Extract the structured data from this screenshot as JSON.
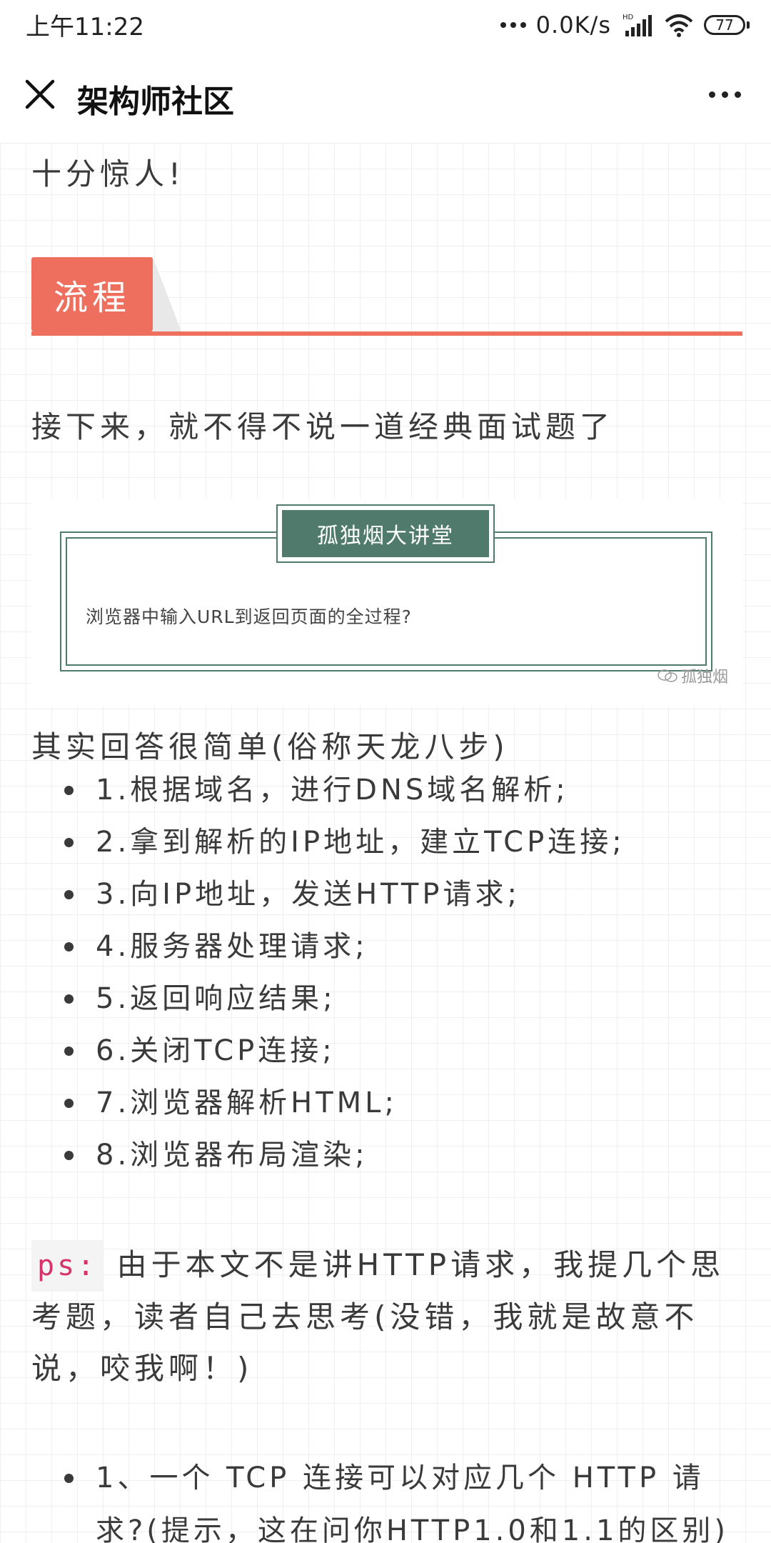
{
  "status_bar": {
    "time": "上午11:22",
    "speed": "0.0K/s",
    "network_badge": "HD",
    "battery": "77"
  },
  "nav": {
    "title": "架构师社区"
  },
  "article": {
    "intro_text": "十分惊人!",
    "section_title": "流程",
    "lead_text": "接下来，就不得不说一道经典面试题了",
    "card": {
      "title": "孤独烟大讲堂",
      "question": "浏览器中输入URL到返回页面的全过程?",
      "watermark": "孤独烟"
    },
    "answer_intro": "其实回答很简单(俗称天龙八步)",
    "steps": [
      "1.根据域名，进行DNS域名解析;",
      "2.拿到解析的IP地址，建立TCP连接;",
      "3.向IP地址，发送HTTP请求;",
      "4.服务器处理请求;",
      "5.返回响应结果;",
      "6.关闭TCP连接;",
      "7.浏览器解析HTML;",
      "8.浏览器布局渲染;"
    ],
    "ps_tag": "ps:",
    "ps_text": "由于本文不是讲HTTP请求，我提几个思考题，读者自己去思考(没错，我就是故意不说，咬我啊！)",
    "questions": [
      "1、一个 TCP 连接可以对应几个 HTTP 请求?(提示，这在问你HTTP1.0和1.1的区别)"
    ]
  }
}
